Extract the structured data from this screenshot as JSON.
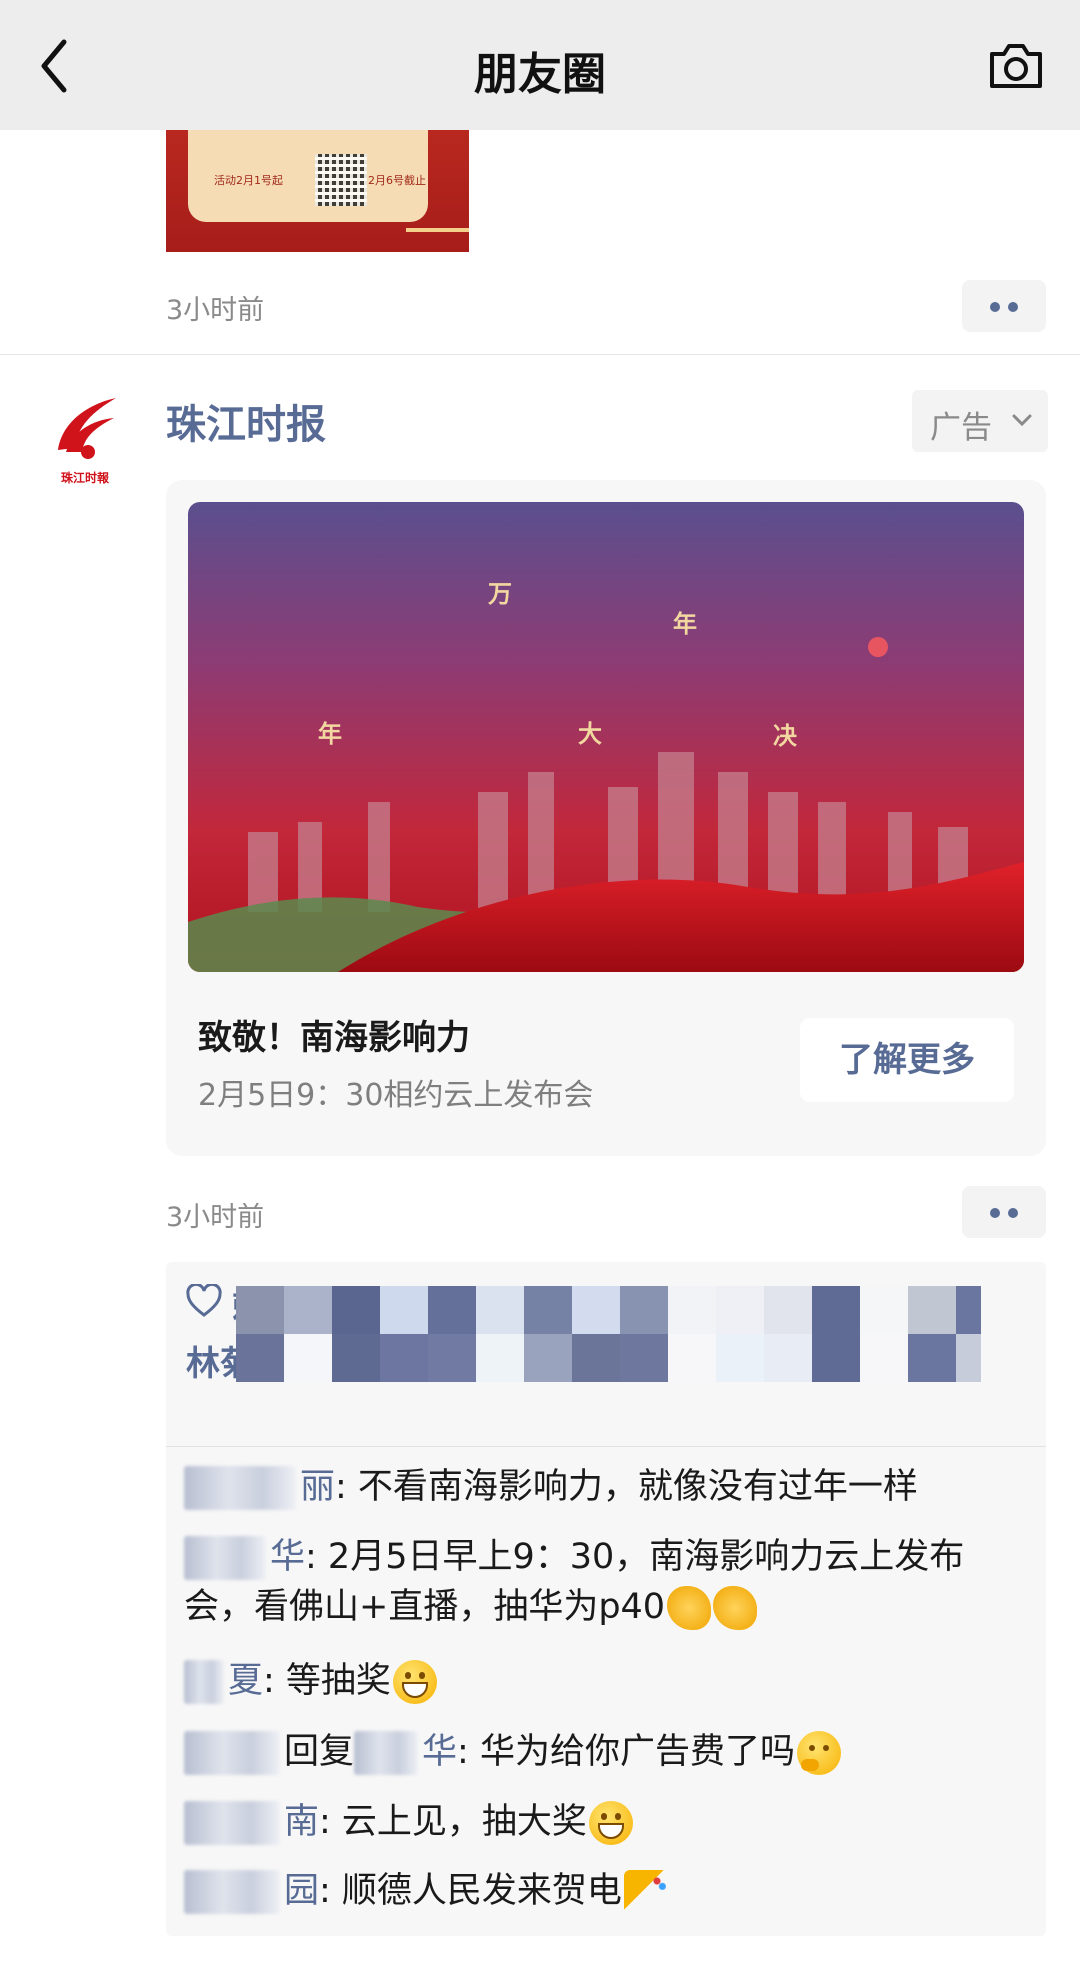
{
  "navbar": {
    "title": "朋友圈",
    "back_icon": "back-chevron-icon",
    "camera_icon": "camera-icon"
  },
  "prev_post": {
    "image_text_left": "活动2月1号起",
    "image_text_right": "2月6号截止",
    "time": "3小时前"
  },
  "ad_post": {
    "author": "珠江时报",
    "logo_text": "珠江时报",
    "ad_label": "广告",
    "banner_glyphs": [
      "年",
      "大",
      "决",
      "万",
      "年"
    ],
    "card_title": "致敬！南海影响力",
    "card_subtitle": "2月5日9：30相约云上发布会",
    "cta_label": "了解更多",
    "time": "3小时前"
  },
  "likes": {
    "names_line1": "赖",
    "names_line2": "林菊,林"
  },
  "comments": [
    {
      "name_visible": "丽",
      "text": ": 不看南海影响力，就像没有过年一样",
      "emoji": ""
    },
    {
      "name_visible": "华",
      "text": ": 2月5日早上9：30，南海影响力云上发布会，看佛山+直播，抽华为p40",
      "emoji": "clap"
    },
    {
      "name_visible": "夏",
      "text": ": 等抽奖",
      "emoji": "grin"
    },
    {
      "name_visible": "",
      "reply_word": "回复",
      "reply_to_visible": "华",
      "text": ": 华为给你广告费了吗",
      "emoji": "think"
    },
    {
      "name_visible": "南",
      "text": ": 云上见，抽大奖",
      "emoji": "grin"
    },
    {
      "name_visible": "园",
      "text": ": 顺德人民发来贺电",
      "emoji": "party"
    }
  ],
  "colors": {
    "link_blue": "#576b95",
    "navbar_bg": "#ededed",
    "ad_red": "#c8101c"
  }
}
